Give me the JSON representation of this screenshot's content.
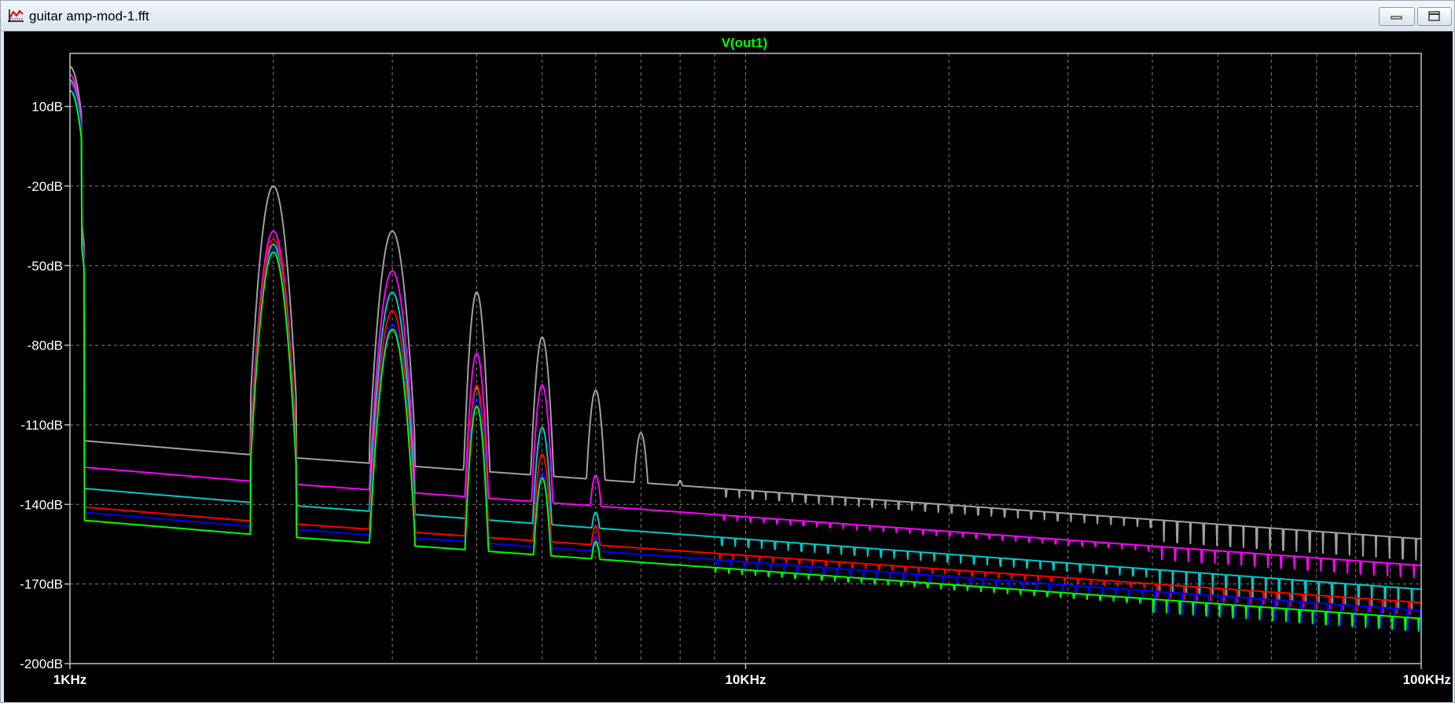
{
  "window": {
    "title": "guitar amp-mod-1.fft",
    "icon": "waveform-plot-icon",
    "minimize_icon": "minimize-icon",
    "restore_icon": "restore-icon"
  },
  "chart_data": {
    "type": "line",
    "title": "V(out1)",
    "xlabel": "",
    "ylabel": "",
    "x_scale": "log",
    "xlim": [
      1000,
      100000
    ],
    "ylim": [
      -200,
      30
    ],
    "grid": true,
    "x_ticks": [
      {
        "value": 1000,
        "label": "1KHz"
      },
      {
        "value": 10000,
        "label": "10KHz"
      },
      {
        "value": 100000,
        "label": "100KHz"
      }
    ],
    "y_ticks": [
      {
        "value": 10,
        "label": "10dB"
      },
      {
        "value": -20,
        "label": "-20dB"
      },
      {
        "value": -50,
        "label": "-50dB"
      },
      {
        "value": -80,
        "label": "-80dB"
      },
      {
        "value": -110,
        "label": "-110dB"
      },
      {
        "value": -140,
        "label": "-140dB"
      },
      {
        "value": -170,
        "label": "-170dB"
      },
      {
        "value": -200,
        "label": "-200dB"
      }
    ],
    "colors": {
      "background": "#000000",
      "grid": "#808080",
      "frame": "#c0c0c0",
      "title": "#00ff00",
      "tick_labels": "#ffffff"
    },
    "harmonic_frequencies": [
      2000,
      3000,
      4000,
      5000,
      6000,
      7000,
      8000
    ],
    "series": [
      {
        "color": "#a0a0a0",
        "fundamental_peak": 25,
        "harmonic_peaks": [
          -20,
          -37,
          -60,
          -77,
          -97,
          -113,
          -131
        ],
        "floor": [
          [
            1050,
            -116
          ],
          [
            1800,
            -121
          ],
          [
            100000,
            -153
          ]
        ]
      },
      {
        "color": "#ff00ff",
        "fundamental_peak": 22,
        "harmonic_peaks": [
          -37,
          -52,
          -83,
          -95,
          -129,
          -145,
          -150
        ],
        "floor": [
          [
            1050,
            -126
          ],
          [
            1800,
            -131
          ],
          [
            100000,
            -163
          ]
        ]
      },
      {
        "color": "#00c8c8",
        "fundamental_peak": 20,
        "harmonic_peaks": [
          -42,
          -60,
          -96,
          -111,
          -143,
          -152,
          -158
        ],
        "floor": [
          [
            1050,
            -134
          ],
          [
            1800,
            -139
          ],
          [
            100000,
            -172
          ]
        ]
      },
      {
        "color": "#ff0000",
        "fundamental_peak": 19,
        "harmonic_peaks": [
          -40,
          -67,
          -95,
          -121,
          -148,
          -158,
          -162
        ],
        "floor": [
          [
            1050,
            -141
          ],
          [
            1800,
            -146
          ],
          [
            100000,
            -177
          ]
        ]
      },
      {
        "color": "#0000ff",
        "fundamental_peak": 18,
        "harmonic_peaks": [
          -44,
          -72,
          -100,
          -128,
          -152,
          -161,
          -165
        ],
        "floor": [
          [
            1050,
            -143
          ],
          [
            1800,
            -148
          ],
          [
            100000,
            -180
          ]
        ]
      },
      {
        "color": "#00ff00",
        "fundamental_peak": 16,
        "harmonic_peaks": [
          -45,
          -74,
          -103,
          -130,
          -154,
          -163,
          -167
        ],
        "floor": [
          [
            1050,
            -146
          ],
          [
            1800,
            -151
          ],
          [
            100000,
            -183
          ]
        ]
      }
    ]
  }
}
